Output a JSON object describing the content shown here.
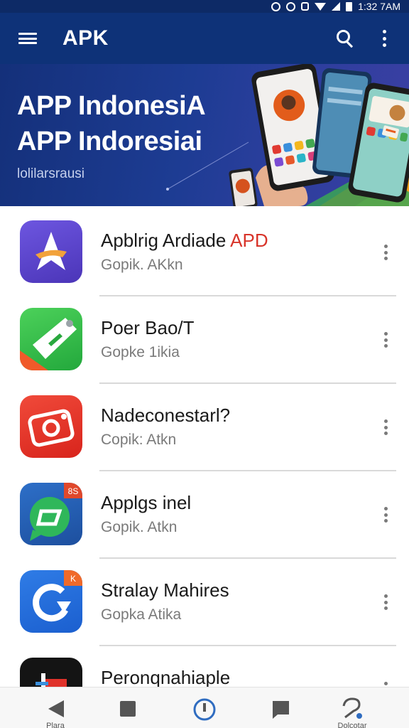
{
  "status_bar": {
    "time": "1:32 7AM"
  },
  "app_bar": {
    "title": "APK"
  },
  "banner": {
    "line1": "APP IndonesiA",
    "line2": "APP Indoresiai",
    "subtitle": "lolilarsrausi"
  },
  "apps": [
    {
      "name": "Apblrig Ardiade ",
      "name_accent": "APD",
      "subtitle": "Gopik. AKkn",
      "icon": "star-app-icon"
    },
    {
      "name": "Poer Bao/T",
      "name_accent": "",
      "subtitle": "Gopke 1ikia",
      "icon": "tool-app-icon"
    },
    {
      "name": "Nadeconestarl?",
      "name_accent": "",
      "subtitle": "Copik: Atkn",
      "icon": "camera-app-icon"
    },
    {
      "name": "Applgs inel",
      "name_accent": "",
      "subtitle": "Gopik. Atkn",
      "icon": "chat-app-icon",
      "badge": "8S"
    },
    {
      "name": "Stralay Mahires",
      "name_accent": "",
      "subtitle": "Gopka Atika",
      "icon": "sync-app-icon",
      "badge": "K"
    },
    {
      "name": "Peronqnahiaple",
      "name_accent": "",
      "subtitle": "",
      "icon": "media-app-icon"
    }
  ],
  "bottom_nav": [
    {
      "label": "Plara",
      "icon": "back-icon"
    },
    {
      "label": "",
      "icon": "stop-icon"
    },
    {
      "label": "",
      "icon": "home-icon"
    },
    {
      "label": "",
      "icon": "message-icon"
    },
    {
      "label": "Dolcotar",
      "icon": "help-icon"
    }
  ],
  "colors": {
    "app_bar": "#0e3278",
    "banner": "#1d3c93",
    "accent_red": "#d8342a",
    "nav_accent": "#2f6cc0"
  }
}
